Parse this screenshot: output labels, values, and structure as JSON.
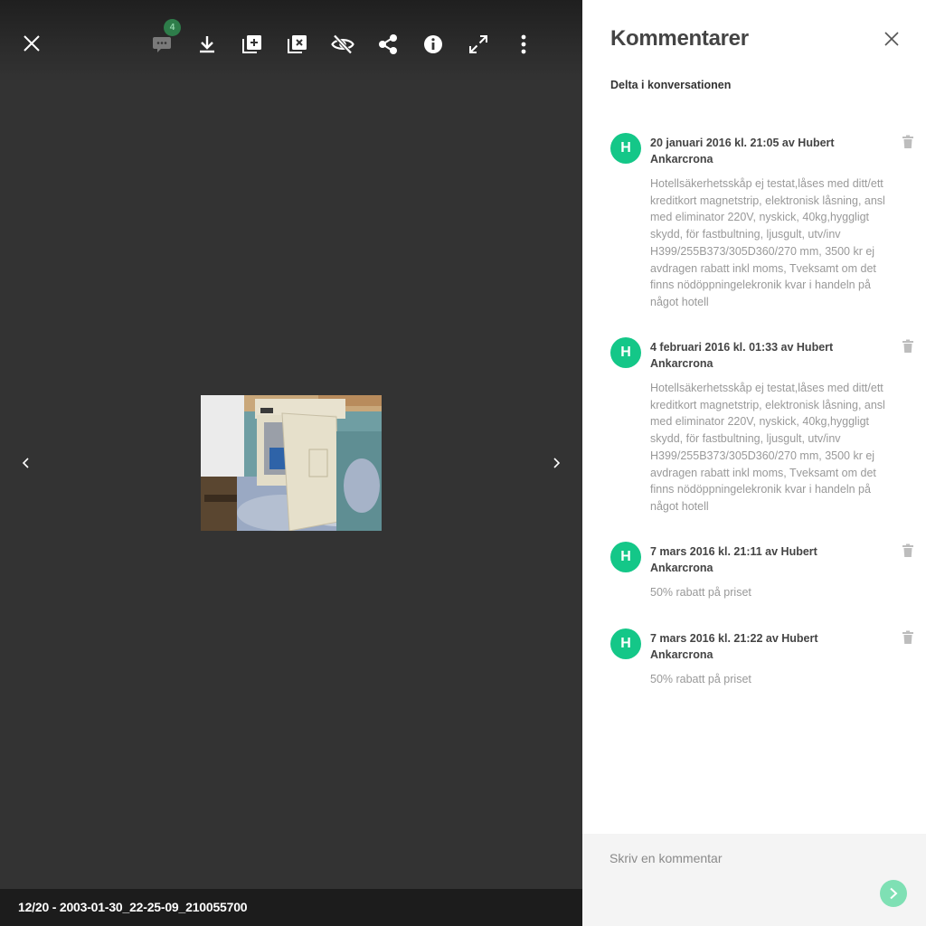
{
  "viewer": {
    "toolbar": {
      "close": "close-icon",
      "comments": {
        "icon": "comment-icon",
        "count": "4"
      },
      "download": "download-icon",
      "add_to_album": "add-to-album-icon",
      "remove_from_album": "remove-from-album-icon",
      "hide": "hide-icon",
      "share": "share-icon",
      "info": "info-icon",
      "fullscreen": "fullscreen-icon",
      "more": "more-vertical-icon"
    },
    "prev": "chevron-left-icon",
    "next": "chevron-right-icon",
    "caption": "12/20 - 2003-01-30_22-25-09_210055700"
  },
  "panel": {
    "title": "Kommentarer",
    "subtitle": "Delta i konversationen",
    "comments": [
      {
        "avatar": "H",
        "meta": "20 januari 2016 kl. 21:05 av Hubert Ankarcrona",
        "body": "Hotellsäkerhetsskåp ej testat,låses med ditt/ett kreditkort magnetstrip, elektronisk låsning, ansl med eliminator 220V, nyskick, 40kg,hyggligt skydd, för fastbultning, ljusgult, utv/inv H399/255B373/305D360/270 mm, 3500 kr ej avdragen rabatt inkl moms, Tveksamt om det finns nödöppningelekronik kvar i handeln på något hotell"
      },
      {
        "avatar": "H",
        "meta": "4 februari 2016 kl. 01:33 av Hubert Ankarcrona",
        "body": "Hotellsäkerhetsskåp ej testat,låses med ditt/ett kreditkort magnetstrip, elektronisk låsning, ansl med eliminator 220V, nyskick, 40kg,hyggligt skydd, för fastbultning, ljusgult, utv/inv H399/255B373/305D360/270 mm, 3500 kr ej avdragen rabatt inkl moms, Tveksamt om det finns nödöppningelekronik kvar i handeln på något hotell"
      },
      {
        "avatar": "H",
        "meta": "7 mars 2016 kl. 21:11 av Hubert Ankarcrona",
        "body": "50% rabatt på priset"
      },
      {
        "avatar": "H",
        "meta": "7 mars 2016 kl. 21:22 av Hubert Ankarcrona",
        "body": "50% rabatt på priset"
      }
    ],
    "compose": {
      "placeholder": "Skriv en kommentar",
      "value": ""
    }
  },
  "colors": {
    "viewer_bg": "#333333",
    "accent": "#14c788",
    "badge": "#2e7d4a"
  }
}
